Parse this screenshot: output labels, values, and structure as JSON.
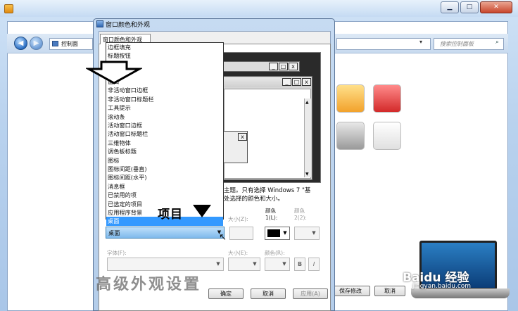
{
  "outer_window": {
    "buttons": {
      "minimize": "▁",
      "maximize": "□",
      "close": "✕"
    }
  },
  "control_panel": {
    "address_text": "控制面",
    "search_placeholder": "搜索控制面板",
    "save_button": "保存修改",
    "cancel_button": "取消"
  },
  "dialog": {
    "title": "窗口颜色和外观",
    "tab_label": "窗口颜色和外观",
    "preview": {
      "btn_min": "_",
      "btn_max": "□",
      "btn_close": "x"
    },
    "description_line1": "主题。只有选择 Windows 7 \"基",
    "description_line2": "处选择的颜色和大小。",
    "item_list": [
      "边框填充",
      "标题按钮",
      "菜单",
      "窗口",
      "非活动窗口边框",
      "非活动窗口标题栏",
      "工具提示",
      "滚动条",
      "活动窗口边框",
      "活动窗口标题栏",
      "三维物体",
      "调色板标题",
      "图标",
      "图标间距(垂直)",
      "图标间距(水平)",
      "消息框",
      "已禁用的项",
      "已选定的项目",
      "应用程序背景",
      "桌面"
    ],
    "selected_item": "桌面",
    "combo_value": "桌面",
    "size1_label": "大小(Z):",
    "color1_label": "颜色\n1(L):",
    "color2_label": "颜色\n2(2):",
    "font_label": "字体(F):",
    "size2_label": "大小(E):",
    "color3_label": "颜色(R):",
    "bold_label": "B",
    "italic_label": "I",
    "ok_button": "确定",
    "cancel_button": "取消",
    "apply_button": "应用(A)"
  },
  "annotations": {
    "item_label": "项目",
    "advanced_label": "高级外观设置"
  },
  "watermark": {
    "brand": "Baidu 经验",
    "url": "jingyan.baidu.com"
  },
  "colors": {
    "selection": "#3399ff",
    "frame": "#b9d2ee",
    "color1_swatch": "#000000"
  }
}
